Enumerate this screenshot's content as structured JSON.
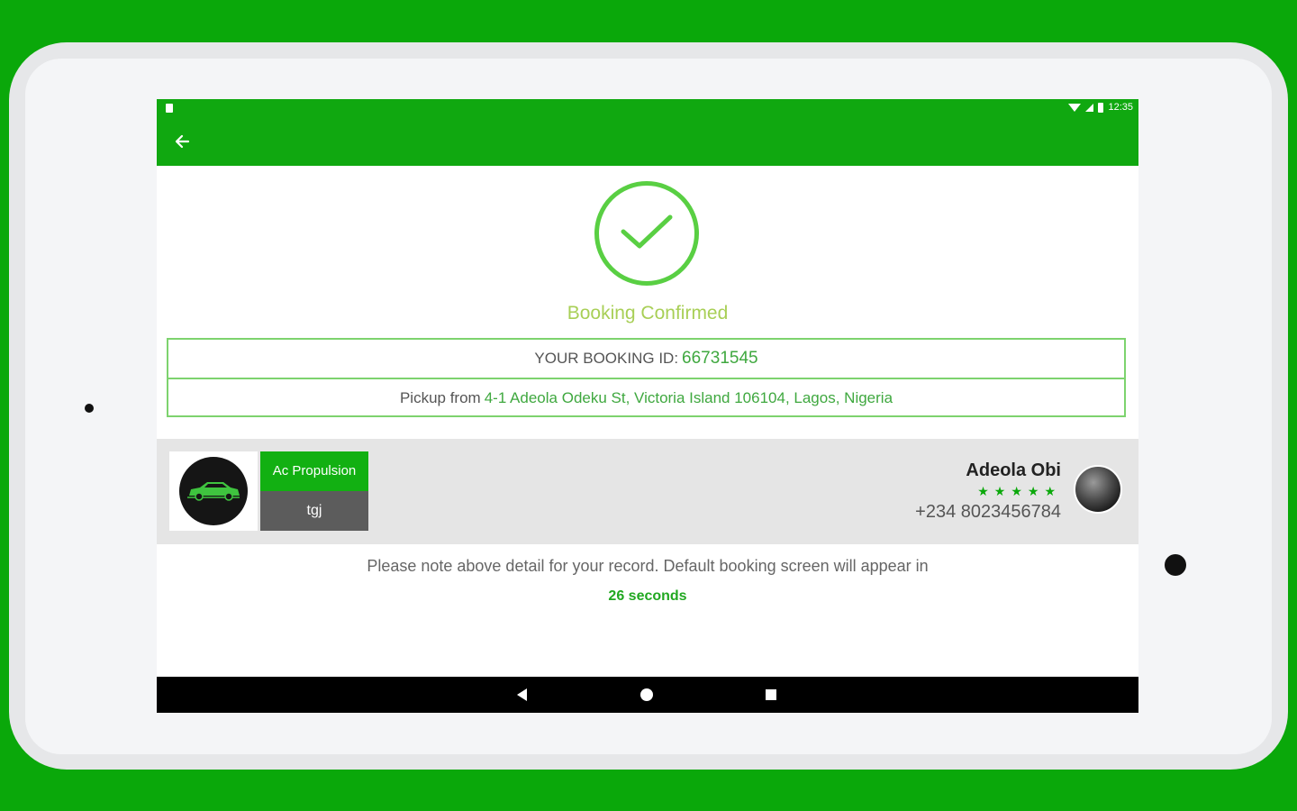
{
  "status_bar": {
    "time": "12:35"
  },
  "confirmation": {
    "title": "Booking Confirmed",
    "booking_id_label": "YOUR BOOKING ID:",
    "booking_id": "66731545",
    "pickup_label": "Pickup from",
    "pickup_address": "4-1 Adeola Odeku St, Victoria Island 106104, Lagos, Nigeria"
  },
  "driver": {
    "car_type": "Ac Propulsion",
    "car_plate": "tgj",
    "name": "Adeola Obi",
    "rating_stars": "★★★★★",
    "phone": "+234 8023456784"
  },
  "note": {
    "text": "Please note above detail for your record. Default booking screen will appear in",
    "countdown": "26 seconds"
  },
  "colors": {
    "primary": "#10a810",
    "accent": "#59cf43",
    "title": "#a8cf56"
  },
  "icons": [
    "back-arrow-icon",
    "check-icon",
    "car-icon",
    "wifi-icon",
    "signal-icon",
    "battery-icon"
  ]
}
